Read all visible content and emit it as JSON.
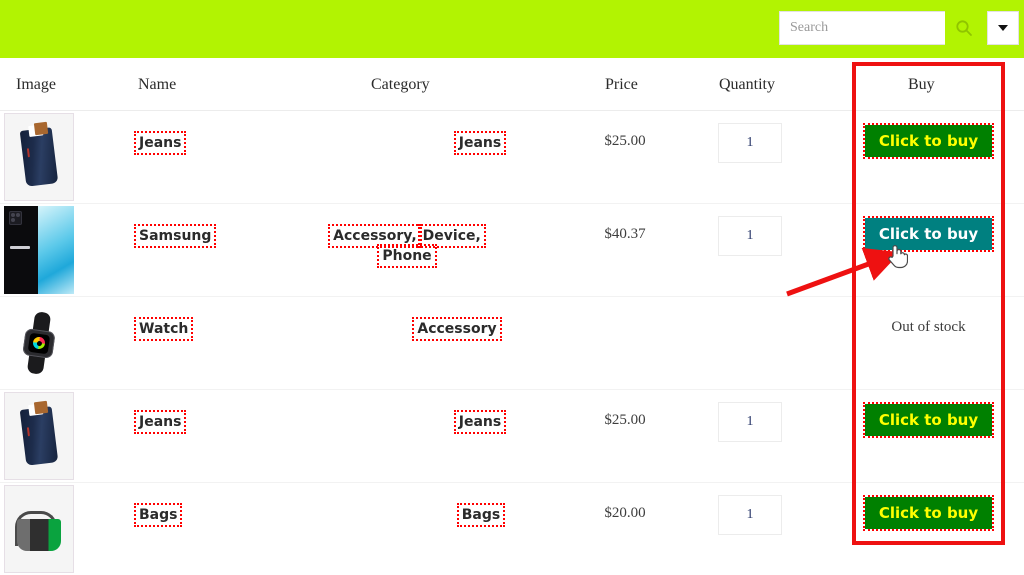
{
  "header": {
    "bar_color": "#b2f302",
    "search": {
      "placeholder": "Search",
      "value": "",
      "search_icon": "search-icon",
      "dropdown_icon": "chevron-down-icon"
    }
  },
  "table": {
    "columns": [
      "Image",
      "Name",
      "Category",
      "Price",
      "Quantity",
      "Buy"
    ],
    "rows": [
      {
        "image": "jeans-thumbnail",
        "name": "Jeans",
        "categories": [
          "Jeans"
        ],
        "price": "$25.00",
        "quantity": "1",
        "buy_label": "Click to buy",
        "buy_state": "available",
        "buy_bg": "#008000",
        "buy_fg": "#ffff00"
      },
      {
        "image": "samsung-phone-thumbnail",
        "name": "Samsung",
        "categories": [
          "Accessory,",
          "Device,",
          "Phone"
        ],
        "price": "$40.37",
        "quantity": "1",
        "buy_label": "Click to buy",
        "buy_state": "hovered",
        "buy_bg": "#008080",
        "buy_fg": "#ffffff"
      },
      {
        "image": "watch-thumbnail",
        "name": "Watch",
        "categories": [
          "Accessory"
        ],
        "price": "",
        "quantity": "",
        "buy_label": "Out of stock",
        "buy_state": "out-of-stock",
        "buy_bg": "",
        "buy_fg": "#3d3d3d"
      },
      {
        "image": "jeans-thumbnail",
        "name": "Jeans",
        "categories": [
          "Jeans"
        ],
        "price": "$25.00",
        "quantity": "1",
        "buy_label": "Click to buy",
        "buy_state": "available",
        "buy_bg": "#008000",
        "buy_fg": "#ffff00"
      },
      {
        "image": "bag-thumbnail",
        "name": "Bags",
        "categories": [
          "Bags"
        ],
        "price": "$20.00",
        "quantity": "1",
        "buy_label": "Click to buy",
        "buy_state": "available",
        "buy_bg": "#008000",
        "buy_fg": "#ffff00"
      }
    ]
  },
  "annotations": {
    "highlight_color": "#ee1111",
    "dotted_outline_color": "#ff0000",
    "arrow_color": "#ee1111",
    "cursor_icon": "pointer-hand-cursor"
  }
}
